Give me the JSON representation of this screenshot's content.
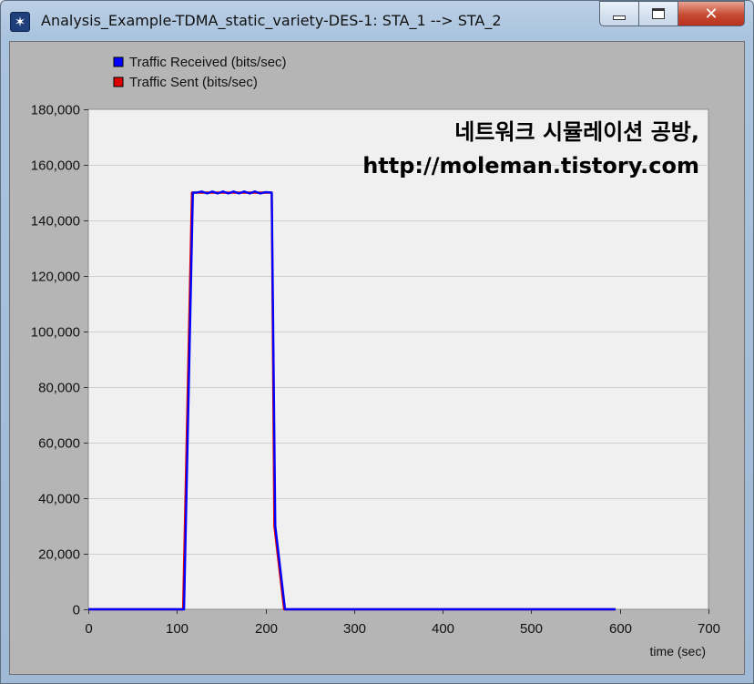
{
  "window": {
    "title": "Analysis_Example-TDMA_static_variety-DES-1: STA_1 --> STA_2",
    "icon": "app-star-icon",
    "buttons": {
      "minimize": "minimize-icon",
      "maximize": "maximize-icon",
      "close": "close-icon",
      "close_glyph": "✕"
    }
  },
  "chart_data": {
    "type": "line",
    "title": "",
    "xlabel": "time (sec)",
    "ylabel": "",
    "xlim": [
      0,
      700
    ],
    "ylim": [
      0,
      180000
    ],
    "x_ticks": [
      "0",
      "100",
      "200",
      "300",
      "400",
      "500",
      "600",
      "700"
    ],
    "y_ticks": [
      "0",
      "20,000",
      "40,000",
      "60,000",
      "80,000",
      "100,000",
      "120,000",
      "140,000",
      "160,000",
      "180,000"
    ],
    "grid": true,
    "legend_position": "top-left",
    "annotations": [
      "네트워크 시뮬레이션 공방,",
      "http://moleman.tistory.com"
    ],
    "series": [
      {
        "name": "Traffic Received (bits/sec)",
        "color": "#0000ff",
        "x": [
          0,
          108,
          118,
          122,
          128,
          134,
          140,
          146,
          152,
          158,
          164,
          170,
          176,
          182,
          188,
          194,
          200,
          207,
          211,
          222,
          595
        ],
        "y": [
          0,
          0,
          150000,
          150000,
          150400,
          149700,
          150400,
          149700,
          150400,
          149700,
          150400,
          149700,
          150400,
          149700,
          150400,
          149700,
          150200,
          150000,
          30000,
          0,
          0
        ]
      },
      {
        "name": "Traffic Sent (bits/sec)",
        "color": "#dd0000",
        "x": [
          0,
          107,
          117,
          207,
          210,
          221,
          595
        ],
        "y": [
          0,
          0,
          150000,
          150000,
          30000,
          0,
          0
        ]
      }
    ]
  }
}
